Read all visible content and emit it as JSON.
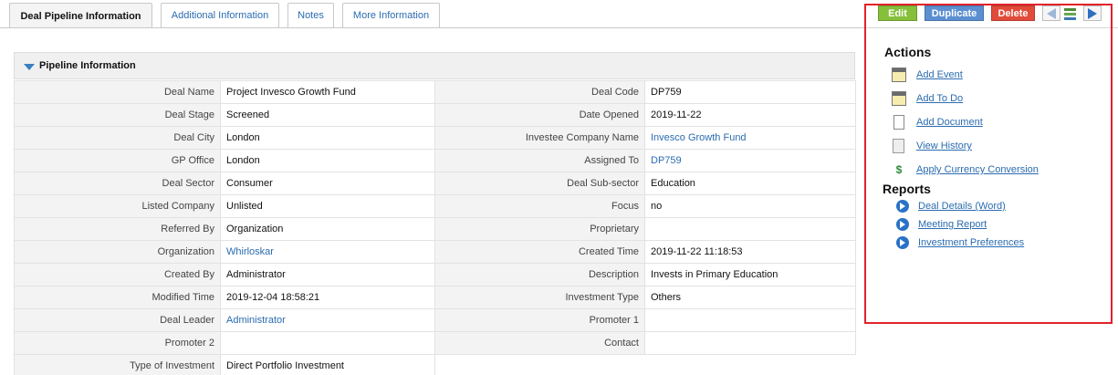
{
  "tabs": [
    {
      "label": "Deal Pipeline Information",
      "active": true
    },
    {
      "label": "Additional Information",
      "active": false
    },
    {
      "label": "Notes",
      "active": false
    },
    {
      "label": "More Information",
      "active": false
    }
  ],
  "section": {
    "title": "Pipeline Information"
  },
  "rows": [
    {
      "l1": "Deal Name",
      "v1": "Project Invesco Growth Fund",
      "l2": "Deal Code",
      "v2": "DP759"
    },
    {
      "l1": "Deal Stage",
      "v1": "Screened",
      "l2": "Date Opened",
      "v2": "2019-11-22"
    },
    {
      "l1": "Deal City",
      "v1": "London",
      "l2": "Investee Company Name",
      "v2": "Invesco Growth Fund"
    },
    {
      "l1": "GP Office",
      "v1": "London",
      "l2": "Assigned To",
      "v2": "DP759"
    },
    {
      "l1": "Deal Sector",
      "v1": "Consumer",
      "l2": "Deal Sub-sector",
      "v2": "Education"
    },
    {
      "l1": "Listed Company",
      "v1": "Unlisted",
      "l2": "Focus",
      "v2": "no"
    },
    {
      "l1": "Referred By",
      "v1": "Organization",
      "l2": "Proprietary",
      "v2": ""
    },
    {
      "l1": "Organization",
      "v1": "Whirloskar",
      "l2": "Created Time",
      "v2": "2019-11-22 11:18:53"
    },
    {
      "l1": "Created By",
      "v1": "Administrator",
      "l2": "Description",
      "v2": "Invests in Primary Education"
    },
    {
      "l1": "Modified Time",
      "v1": "2019-12-04 18:58:21",
      "l2": "Investment Type",
      "v2": "Others"
    },
    {
      "l1": "Deal Leader",
      "v1": "Administrator",
      "l2": "Promoter 1",
      "v2": ""
    },
    {
      "l1": "Promoter 2",
      "v1": "",
      "l2": "Contact",
      "v2": ""
    },
    {
      "l1": "Type of Investment",
      "v1": "Direct Portfolio Investment",
      "l2": "",
      "v2": ""
    }
  ],
  "toolbar": {
    "edit_label": "Edit",
    "duplicate_label": "Duplicate",
    "delete_label": "Delete",
    "prev_icon": "arrow-left-icon",
    "list_icon": "list-view-icon",
    "next_icon": "arrow-right-icon"
  },
  "actions": {
    "title": "Actions",
    "items": [
      {
        "label": "Add Event",
        "icon": "calendar-event-icon"
      },
      {
        "label": "Add To Do",
        "icon": "calendar-todo-icon"
      },
      {
        "label": "Add Document",
        "icon": "document-icon"
      },
      {
        "label": "View History",
        "icon": "history-icon"
      },
      {
        "label": "Apply Currency Conversion",
        "icon": "currency-icon"
      }
    ]
  },
  "reports": {
    "title": "Reports",
    "items": [
      {
        "label": "Deal Details (Word)",
        "icon": "arrow-circle-right-icon"
      },
      {
        "label": "Meeting Report",
        "icon": "arrow-circle-right-icon"
      },
      {
        "label": "Investment Preferences",
        "icon": "arrow-circle-right-icon"
      }
    ]
  },
  "colors": {
    "edit": "#86bf3a",
    "duplicate": "#5b8fd1",
    "delete": "#e14b3a",
    "link": "#2b6cb0",
    "highlight_border": "#e2222b"
  }
}
